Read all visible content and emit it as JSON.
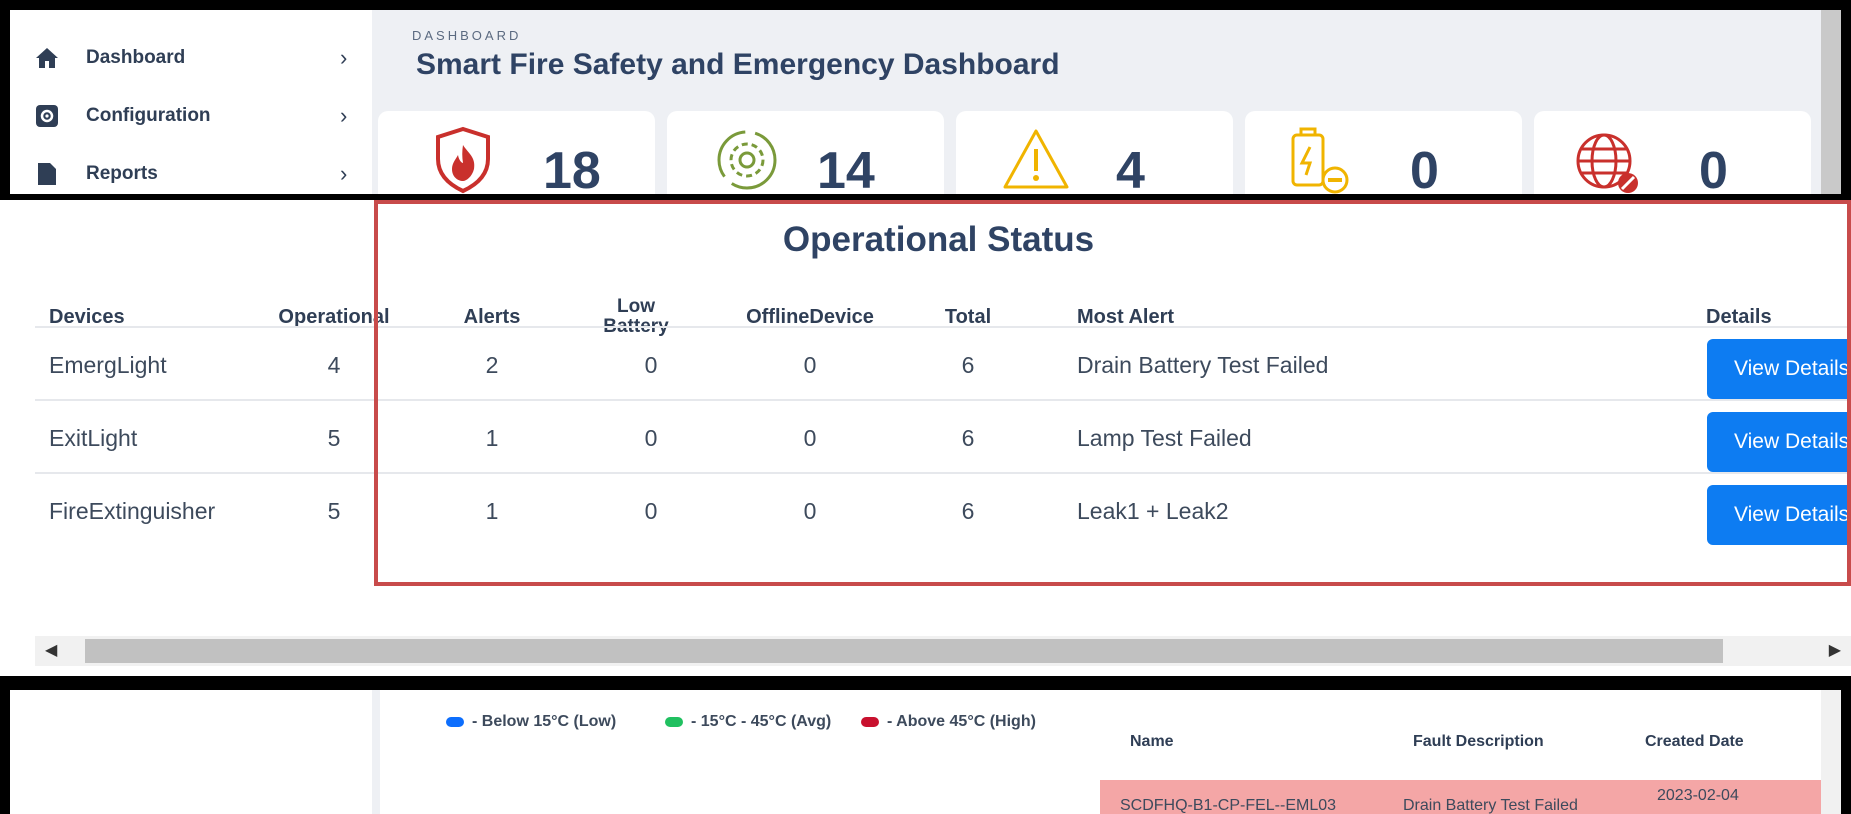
{
  "sidebar": {
    "items": [
      {
        "label": "Dashboard",
        "icon": "home-icon"
      },
      {
        "label": "Configuration",
        "icon": "gear-icon"
      },
      {
        "label": "Reports",
        "icon": "report-icon"
      }
    ]
  },
  "header": {
    "breadcrumb": "DASHBOARD",
    "title": "Smart Fire Safety and Emergency Dashboard"
  },
  "cards": [
    {
      "value": "18",
      "icon": "fire-shield-icon",
      "color": "#c9302c"
    },
    {
      "value": "14",
      "icon": "operational-gear-icon",
      "color": "#7a9a3a"
    },
    {
      "value": "4",
      "icon": "warning-icon",
      "color": "#f0b400"
    },
    {
      "value": "0",
      "icon": "low-battery-icon",
      "color": "#f0b400"
    },
    {
      "value": "0",
      "icon": "offline-globe-icon",
      "color": "#c9302c"
    }
  ],
  "operational": {
    "title": "Operational Status",
    "headers": {
      "devices": "Devices",
      "operational": "Operational",
      "alerts": "Alerts",
      "low_battery_1": "Low",
      "low_battery_2": "Battery",
      "offline": "OfflineDevice",
      "total": "Total",
      "most_alert": "Most Alert",
      "details": "Details"
    },
    "rows": [
      {
        "device": "EmergLight",
        "operational": "4",
        "alerts": "2",
        "low_battery": "0",
        "offline": "0",
        "total": "6",
        "most_alert": "Drain Battery Test Failed",
        "button": "View Details"
      },
      {
        "device": "ExitLight",
        "operational": "5",
        "alerts": "1",
        "low_battery": "0",
        "offline": "0",
        "total": "6",
        "most_alert": "Lamp Test Failed",
        "button": "View Details"
      },
      {
        "device": "FireExtinguisher",
        "operational": "5",
        "alerts": "1",
        "low_battery": "0",
        "offline": "0",
        "total": "6",
        "most_alert": "Leak1 + Leak2",
        "button": "View Details"
      }
    ]
  },
  "legend": [
    {
      "label": "- Below 15°C (Low)",
      "color": "#0d6efd"
    },
    {
      "label": "- 15°C - 45°C (Avg)",
      "color": "#20c060"
    },
    {
      "label": "- Above 45°C (High)",
      "color": "#c8102e"
    }
  ],
  "faults": {
    "headers": {
      "name": "Name",
      "description": "Fault Description",
      "created": "Created Date"
    },
    "rows": [
      {
        "name": "SCDFHQ-B1-CP-FEL--EML03",
        "description": "Drain Battery Test Failed",
        "created": "2023-02-04"
      }
    ]
  }
}
